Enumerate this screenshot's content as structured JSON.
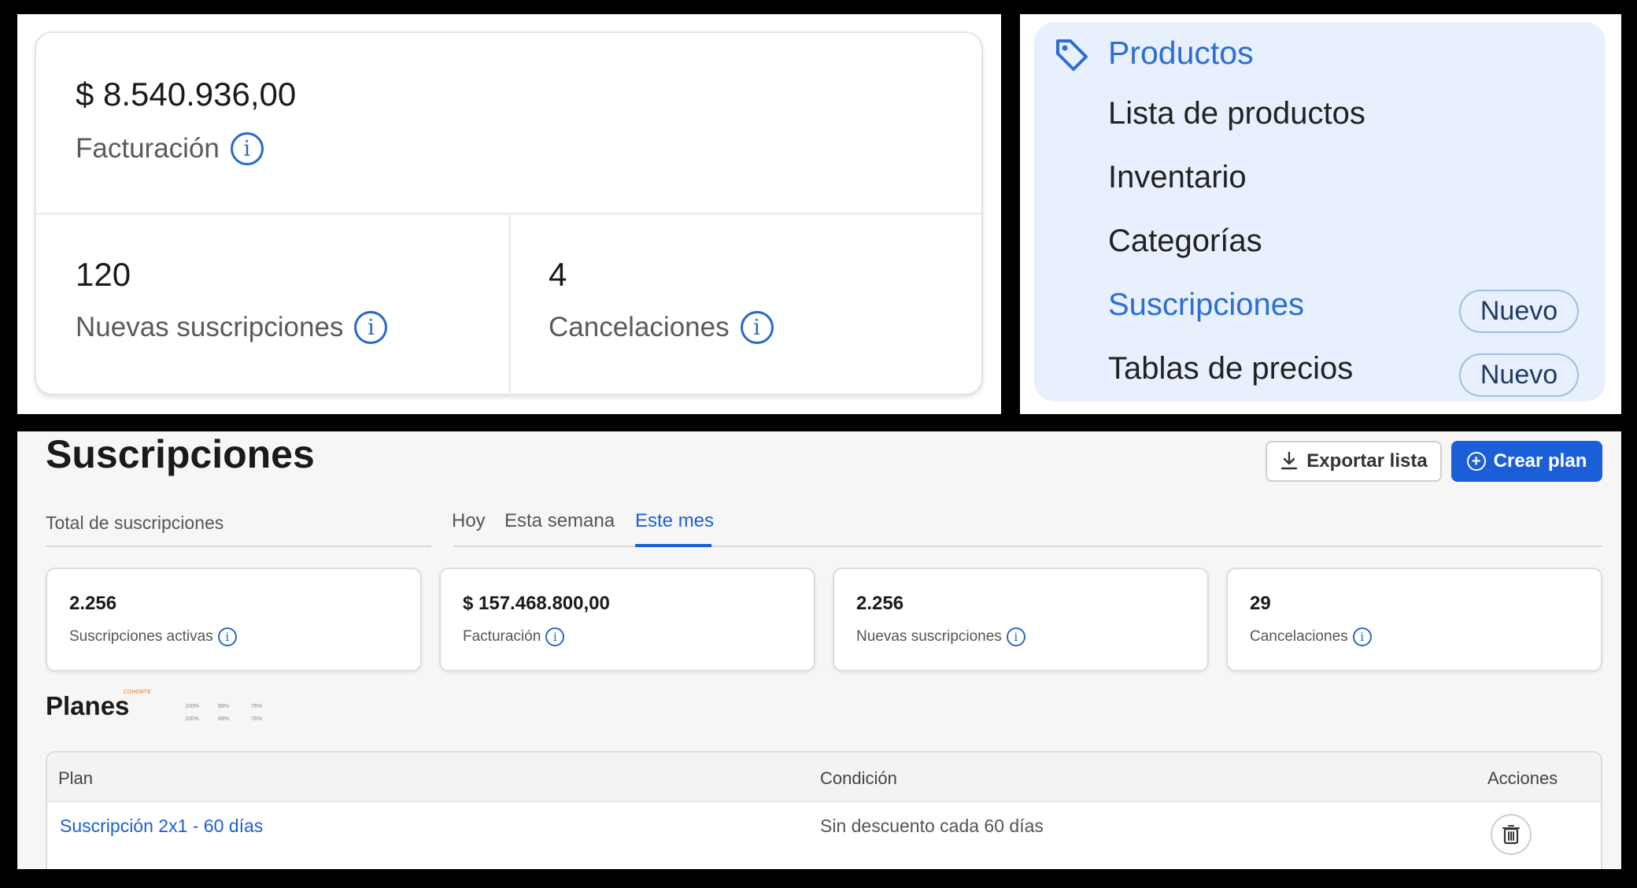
{
  "metrics": {
    "billing_value": "$ 8.540.936,00",
    "billing_label": "Facturación",
    "new_subs_value": "120",
    "new_subs_label": "Nuevas suscripciones",
    "cancel_value": "4",
    "cancel_label": "Cancelaciones",
    "info_glyph": "i"
  },
  "menu": {
    "header": "Productos",
    "header_icon": "tag-icon",
    "items": [
      {
        "label": "Lista de productos",
        "badge": ""
      },
      {
        "label": "Inventario",
        "badge": ""
      },
      {
        "label": "Categorías",
        "badge": ""
      },
      {
        "label": "Suscripciones",
        "badge": "Nuevo",
        "active": true
      },
      {
        "label": "Tablas de precios",
        "badge": "Nuevo"
      }
    ]
  },
  "subscriptions": {
    "title": "Suscripciones",
    "export_label": "Exportar lista",
    "create_label": "Crear plan",
    "total_label": "Total de suscripciones",
    "tabs": [
      "Hoy",
      "Esta semana",
      "Este mes"
    ],
    "active_tab": "Este mes",
    "stats": [
      {
        "value": "2.256",
        "label": "Suscripciones activas"
      },
      {
        "value": "$ 157.468.800,00",
        "label": "Facturación"
      },
      {
        "value": "2.256",
        "label": "Nuevas suscripciones"
      },
      {
        "value": "29",
        "label": "Cancelaciones"
      }
    ],
    "plans_title": "Planes",
    "plans_overlay": {
      "header": "COHORTE",
      "cells": [
        "100%",
        "88%",
        "76%",
        "100%",
        "88%",
        "76%"
      ]
    },
    "table": {
      "headers": [
        "Plan",
        "Condición",
        "Acciones"
      ],
      "rows": [
        {
          "plan": "Suscripción 2x1 - 60 días",
          "condition": "Sin descuento cada 60 días"
        }
      ]
    },
    "colors": {
      "accent": "#1b5fd8",
      "menu_bg": "#e8f0fd"
    }
  }
}
